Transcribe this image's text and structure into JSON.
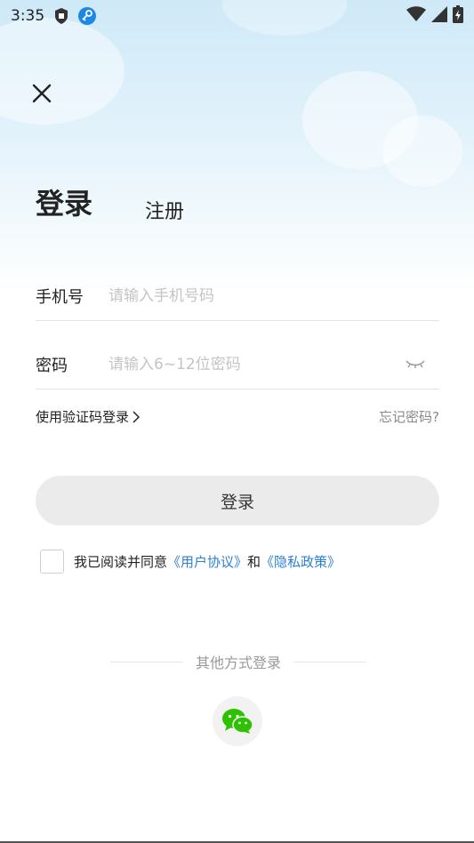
{
  "status_bar": {
    "time": "3:35",
    "icons": [
      "shield-icon",
      "vpn-key-icon",
      "wifi-icon",
      "signal-icon",
      "battery-charging-icon"
    ]
  },
  "header": {
    "close_icon": "close-icon",
    "tab_login": "登录",
    "tab_register": "注册"
  },
  "form": {
    "phone_label": "手机号",
    "phone_placeholder": "请输入手机号码",
    "phone_value": "",
    "password_label": "密码",
    "password_placeholder": "请输入6~12位密码",
    "password_value": "",
    "password_toggle_icon": "eye-closed-icon"
  },
  "links": {
    "sms_login": "使用验证码登录",
    "forgot_password": "忘记密码?"
  },
  "login_button": "登录",
  "agreement": {
    "checked": false,
    "prefix": "我已阅读并同意",
    "user_agreement": "《用户协议》",
    "and": "和",
    "privacy_policy": "《隐私政策》"
  },
  "other_login": {
    "title": "其他方式登录",
    "wechat_icon": "wechat-icon"
  },
  "colors": {
    "link": "#2b7fd4",
    "button_bg": "#ebebeb",
    "wechat_green": "#2dc100"
  }
}
